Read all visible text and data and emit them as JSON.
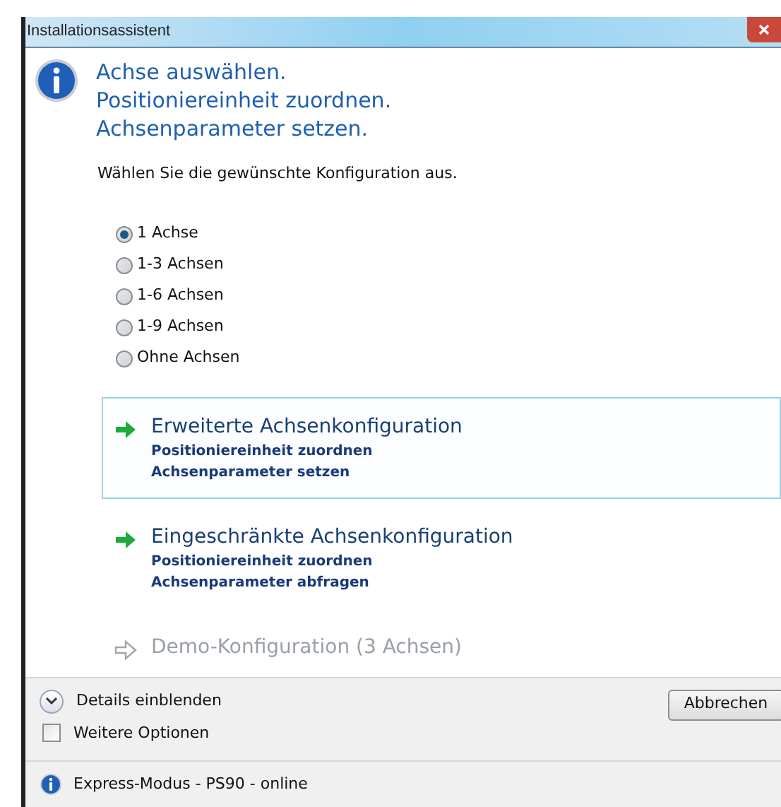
{
  "window": {
    "title": "Installationsassistent"
  },
  "heading": [
    "Achse auswählen.",
    "Positioniereinheit zuordnen.",
    "Achsenparameter setzen."
  ],
  "instruction": "Wählen Sie die gewünschte Konfiguration aus.",
  "options": [
    {
      "label": "1 Achse",
      "selected": true
    },
    {
      "label": "1-3 Achsen",
      "selected": false
    },
    {
      "label": "1-6 Achsen",
      "selected": false
    },
    {
      "label": "1-9 Achsen",
      "selected": false
    },
    {
      "label": "Ohne Achsen",
      "selected": false
    }
  ],
  "command_links": [
    {
      "title": "Erweiterte Achsenkonfiguration",
      "lines": [
        "Positioniereinheit zuordnen",
        "Achsenparameter setzen"
      ],
      "focused": true,
      "disabled": false
    },
    {
      "title": "Eingeschränkte Achsenkonfiguration",
      "lines": [
        "Positioniereinheit zuordnen",
        "Achsenparameter abfragen"
      ],
      "focused": false,
      "disabled": false
    },
    {
      "title": "Demo-Konfiguration (3 Achsen)",
      "focused": false,
      "disabled": true
    }
  ],
  "footer": {
    "details": {
      "label": "Details einblenden",
      "expanded": false
    },
    "more_options": {
      "label": "Weitere Optionen",
      "checked": false
    },
    "cancel_button": "Abbrechen"
  },
  "status_bar": "Express-Modus - PS90 - online"
}
